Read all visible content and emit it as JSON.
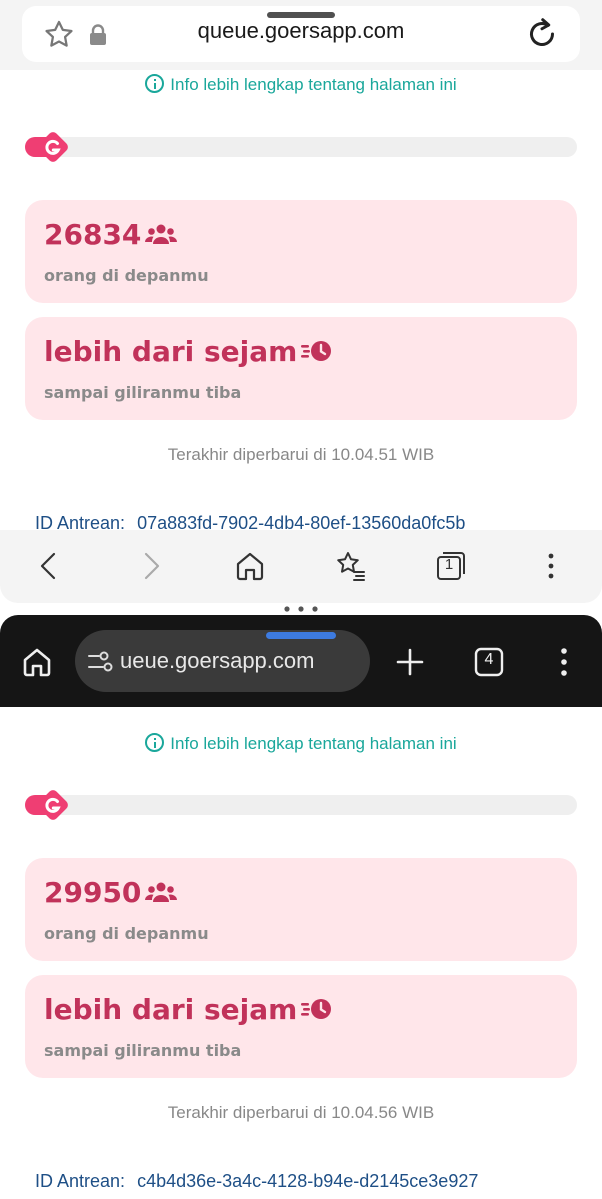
{
  "top_window": {
    "url": "queue.goersapp.com",
    "info_link": "Info lebih lengkap tentang halaman ini",
    "progress_fraction": 0.06,
    "people_count": "26834",
    "people_label": "orang di depanmu",
    "eta": "lebih dari sejam",
    "eta_label": "sampai giliranmu tiba",
    "updated": "Terakhir diperbarui di 10.04.51 WIB",
    "queue_id_label": "ID Antrean:",
    "queue_id_value": "07a883fd-7902-4db4-80ef-13560da0fc5b",
    "bottom_nav": [
      "back-icon",
      "forward-icon",
      "home-icon",
      "bookmarks-icon",
      "tabs-icon",
      "more-icon"
    ],
    "tab_count": "1"
  },
  "bottom_window": {
    "url": "ueue.goersapp.com",
    "tab_count": "4",
    "toolbar_icons": [
      "home-icon",
      "site-settings-icon",
      "new-tab-icon",
      "tabs-icon",
      "more-icon"
    ],
    "info_link": "Info lebih lengkap tentang halaman ini",
    "progress_fraction": 0.06,
    "people_count": "29950",
    "people_label": "orang di depanmu",
    "eta": "lebih dari sejam",
    "eta_label": "sampai giliranmu tiba",
    "updated": "Terakhir diperbarui di 10.04.56 WIB",
    "queue_id_label": "ID Antrean:",
    "queue_id_value": "c4b4d36e-3a4c-4128-b94e-d2145ce3e927"
  },
  "colors": {
    "accent_pink": "#ef3e73",
    "card_bg": "#ffe6ea",
    "card_text": "#c1325a",
    "info_teal": "#1aa79b",
    "queue_id_blue": "#1e4f86"
  }
}
